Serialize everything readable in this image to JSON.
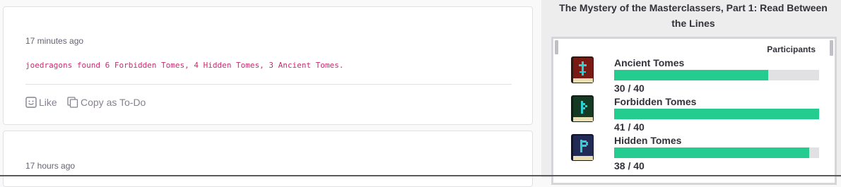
{
  "feed": {
    "card1": {
      "timestamp": "17 minutes ago",
      "message": "joedragons found 6 Forbidden Tomes, 4 Hidden Tomes, 3 Ancient Tomes.",
      "like_label": "Like",
      "copy_label": "Copy as To-Do"
    },
    "card2": {
      "timestamp": "17 hours ago"
    }
  },
  "quest": {
    "title": "The Mystery of the Masterclassers, Part 1: Read Between the Lines",
    "participants_label": "Participants",
    "items": [
      {
        "name": "Ancient Tomes",
        "count": "30 / 40",
        "progress": 0.75,
        "icon": "ancient-tome-icon",
        "cover": "#7a1a14",
        "rune": "#2ecfd2"
      },
      {
        "name": "Forbidden Tomes",
        "count": "41 / 40",
        "progress": 1.0,
        "icon": "forbidden-tome-icon",
        "cover": "#143a24",
        "rune": "#2ecfd2"
      },
      {
        "name": "Hidden Tomes",
        "count": "38 / 40",
        "progress": 0.95,
        "icon": "hidden-tome-icon",
        "cover": "#222a56",
        "rune": "#2ecfd2"
      }
    ]
  },
  "colors": {
    "message": "#c92b6f",
    "progress_fill": "#24cc8f",
    "progress_track": "#e1e0e3"
  }
}
